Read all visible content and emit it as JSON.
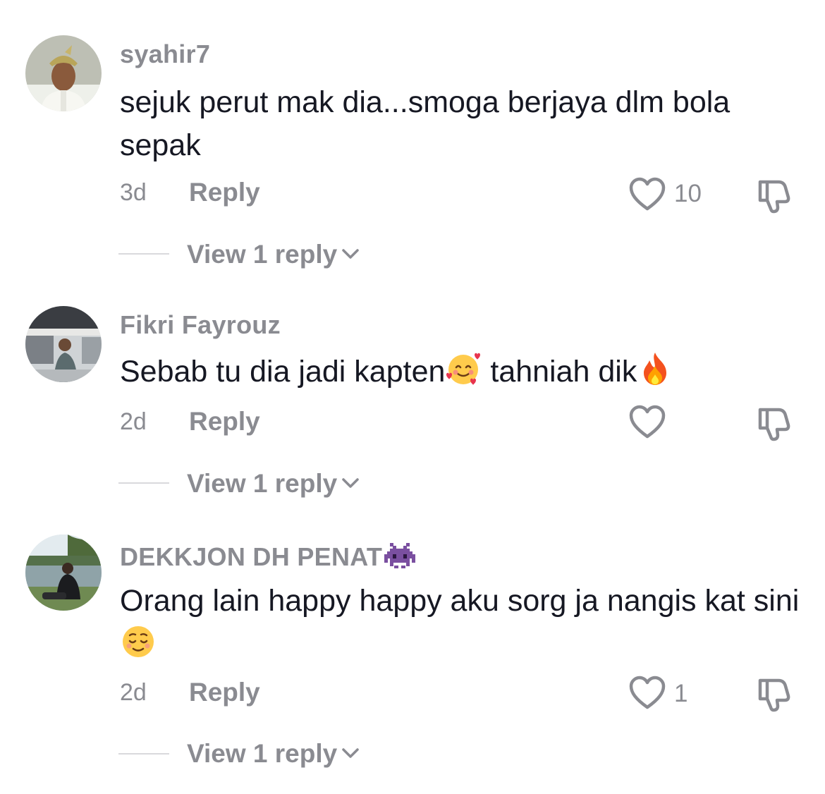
{
  "comments": [
    {
      "username": "syahir7",
      "text": "sejuk perut mak dia...smoga berjaya dlm bola sepak",
      "time": "3d",
      "reply_label": "Reply",
      "likes": "10",
      "view_replies": "View 1 reply"
    },
    {
      "username": "Fikri Fayrouz",
      "text_part1": "Sebab tu dia jadi kapten",
      "text_part2": " tahniah dik",
      "time": "2d",
      "reply_label": "Reply",
      "likes": "",
      "view_replies": "View 1 reply"
    },
    {
      "username": "DEKKJON DH PENAT",
      "text": "Orang lain happy happy aku sorg ja nangis kat sini",
      "time": "2d",
      "reply_label": "Reply",
      "likes": "1",
      "view_replies": "View 1 reply"
    }
  ],
  "icons": {
    "like": "heart-outline-icon",
    "dislike": "thumbs-down-icon",
    "expand": "chevron-down-icon",
    "emoji_smiling_hearts": "smiling-face-with-hearts-emoji",
    "emoji_fire": "fire-emoji",
    "emoji_alien_monster": "alien-monster-emoji",
    "emoji_relieved": "relieved-face-emoji"
  },
  "colors": {
    "primary_text": "#161823",
    "secondary_text": "#8a8b91",
    "divider": "#d9d9dc",
    "background": "#ffffff"
  }
}
